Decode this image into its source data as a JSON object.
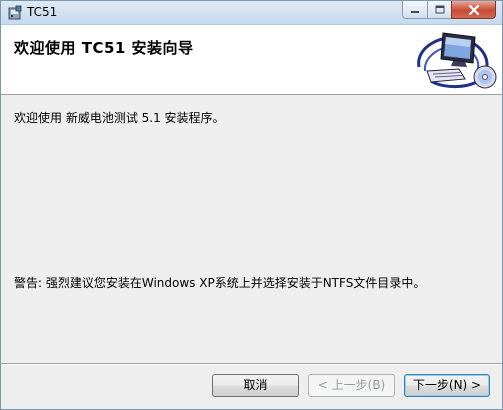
{
  "window": {
    "title": "TC51",
    "icon": "installer-icon",
    "controls": {
      "minimize": "minimize-icon",
      "maximize": "maximize-icon",
      "close": "close-icon"
    }
  },
  "banner": {
    "title": "欢迎使用 TC51 安装向导",
    "graphic": "computer-setup-icon"
  },
  "body": {
    "welcome": "欢迎使用 新威电池测试 5.1 安装程序。",
    "warning": "警告: 强烈建议您安装在Windows XP系统上并选择安装于NTFS文件目录中。"
  },
  "buttons": {
    "cancel": "取消",
    "back": "< 上一步(B)",
    "next": "下一步(N) >"
  },
  "colors": {
    "close_red": "#c94a34",
    "default_button_border": "#3c7fb1",
    "disabled_text": "#9a9a9a"
  }
}
